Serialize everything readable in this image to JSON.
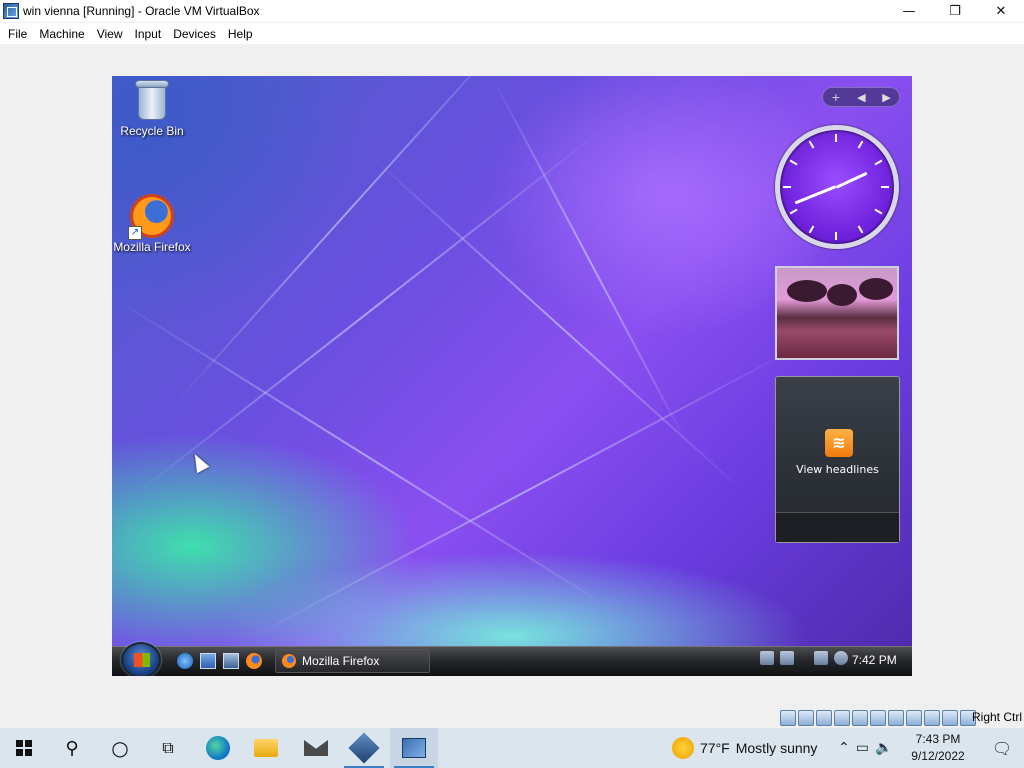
{
  "window": {
    "title": "win vienna [Running] - Oracle VM VirtualBox",
    "minimize": "—",
    "maximize": "❐",
    "close": "✕"
  },
  "menubar": [
    "File",
    "Machine",
    "View",
    "Input",
    "Devices",
    "Help"
  ],
  "guest": {
    "desktop_icons": [
      {
        "label": "Recycle Bin",
        "icon": "recycle-bin-icon"
      },
      {
        "label": "Mozilla Firefox",
        "icon": "firefox-icon"
      }
    ],
    "sidebar": {
      "controls": [
        "+",
        "◀",
        "▶"
      ],
      "feeds_label": "View headlines"
    },
    "taskbar": {
      "quick_launch": [
        "internet-explorer-icon",
        "show-desktop-icon",
        "switch-windows-icon",
        "firefox-icon"
      ],
      "task_button": "Mozilla Firefox",
      "clock": "7:42 PM"
    }
  },
  "vbox_status": {
    "host_key": "Right Ctrl"
  },
  "host_taskbar": {
    "weather": {
      "temp": "77°F",
      "condition": "Mostly sunny"
    },
    "clock": {
      "time": "7:43 PM",
      "date": "9/12/2022"
    },
    "pinned": [
      "start-button",
      "search-button",
      "cortana-button",
      "task-view-button",
      "edge-icon",
      "file-explorer-icon",
      "mail-icon",
      "virtualbox-manager-icon",
      "vm-window-icon"
    ]
  }
}
